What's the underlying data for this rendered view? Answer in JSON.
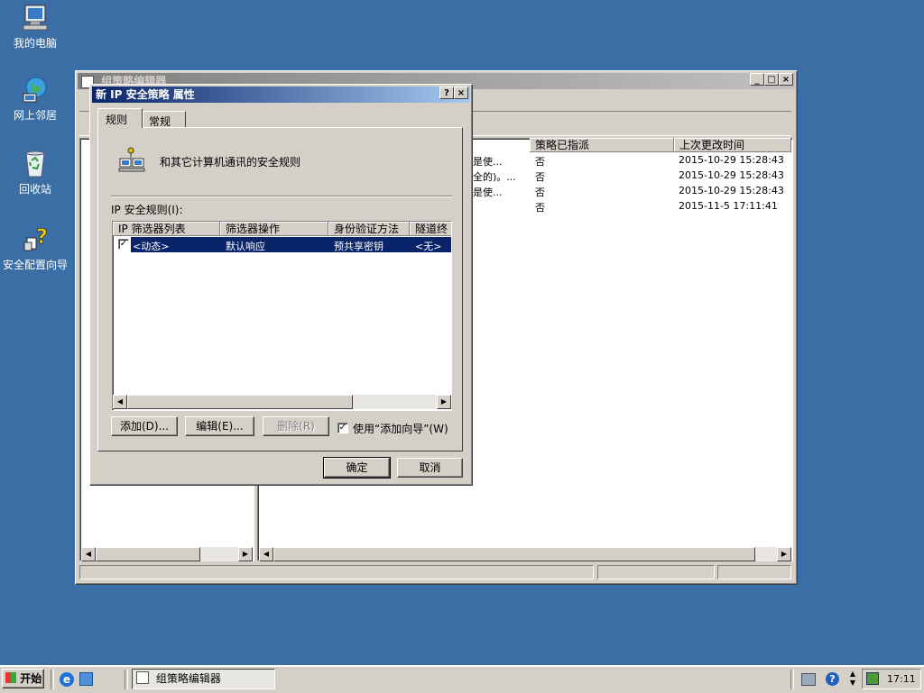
{
  "desktop": {
    "icons": [
      {
        "label": "我的电脑",
        "icon": "computer-icon"
      },
      {
        "label": "网上邻居",
        "icon": "network-icon"
      },
      {
        "label": "回收站",
        "icon": "recycle-bin-icon"
      },
      {
        "label": "安全配置向导",
        "icon": "security-wizard-icon"
      }
    ]
  },
  "gpo_window": {
    "title": "组策略编辑器",
    "columns": [
      "策略已指派",
      "上次更改时间"
    ],
    "rows": [
      {
        "desc": "是使...",
        "assigned": "否",
        "modified": "2015-10-29 15:28:43"
      },
      {
        "desc": "全的)。...",
        "assigned": "否",
        "modified": "2015-10-29 15:28:43"
      },
      {
        "desc": "是使...",
        "assigned": "否",
        "modified": "2015-10-29 15:28:43"
      },
      {
        "desc": "",
        "assigned": "否",
        "modified": "2015-11-5 17:11:41"
      }
    ]
  },
  "dialog": {
    "title": "新 IP 安全策略 属性",
    "help_glyph": "?",
    "close_glyph": "×",
    "tabs": [
      "规则",
      "常规"
    ],
    "description": "和其它计算机通讯的安全规则",
    "rules_label": "IP 安全规则(I):",
    "columns": [
      "IP 筛选器列表",
      "筛选器操作",
      "身份验证方法",
      "隧道终"
    ],
    "rules": [
      {
        "checked": true,
        "filter_list": "<动态>",
        "action": "默认响应",
        "auth": "预共享密钥",
        "tunnel": "<无>"
      }
    ],
    "add_button": "添加(D)...",
    "edit_button": "编辑(E)...",
    "delete_button": "删除(R)",
    "wizard_checkbox": "使用“添加向导”(W)",
    "wizard_checked": true,
    "ok_button": "确定",
    "cancel_button": "取消"
  },
  "taskbar": {
    "start_label": "开始",
    "task_label": "组策略编辑器",
    "clock": "17:11"
  },
  "colors": {
    "desktop": "#3a6ea5",
    "title_active": "#0a246a",
    "selection": "#0a246a"
  }
}
